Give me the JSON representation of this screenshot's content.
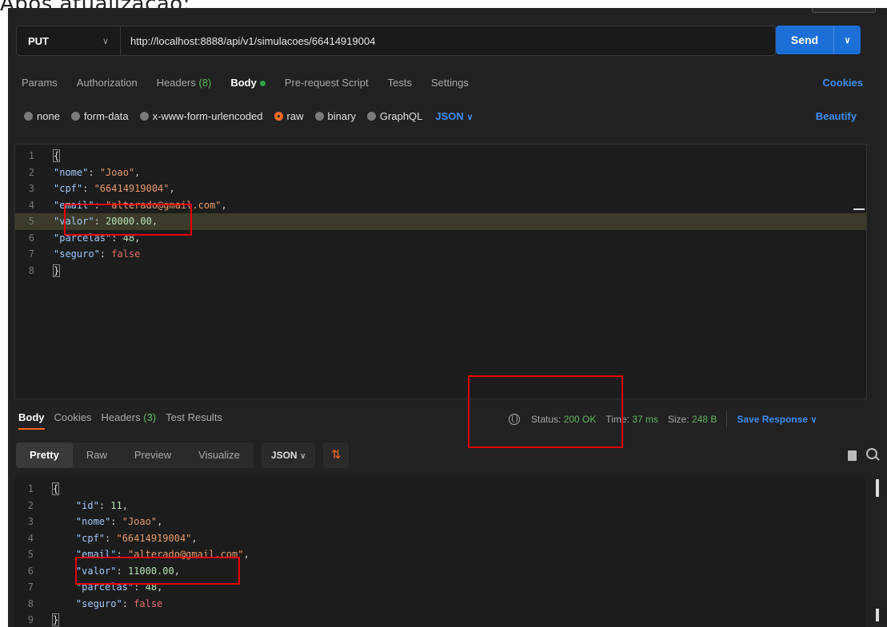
{
  "caption": "Após atualização:",
  "request": {
    "method": "PUT",
    "url": "http://localhost:8888/api/v1/simulacoes/66414919004",
    "send_label": "Send"
  },
  "tabs": [
    {
      "label": "Params"
    },
    {
      "label": "Authorization"
    },
    {
      "label": "Headers",
      "count": "(8)"
    },
    {
      "label": "Body"
    },
    {
      "label": "Pre-request Script"
    },
    {
      "label": "Tests"
    },
    {
      "label": "Settings"
    }
  ],
  "cookies_label": "Cookies",
  "body_types": [
    "none",
    "form-data",
    "x-www-form-urlencoded",
    "raw",
    "binary",
    "GraphQL"
  ],
  "body_format": "JSON",
  "beautify_label": "Beautify",
  "request_body": {
    "line_numbers": [
      "1",
      "2",
      "3",
      "4",
      "5",
      "6",
      "7",
      "8"
    ],
    "l1": "{",
    "l2_key": "\"nome\"",
    "l2_val": "\"Joao\"",
    "l3_key": "\"cpf\"",
    "l3_val": "\"66414919004\"",
    "l4_key": "\"email\"",
    "l4_val": "\"alterado@gmail.com\"",
    "l5_key": "\"valor\"",
    "l5_val": "20000.00",
    "l6_key": "\"parcelas\"",
    "l6_val": "48",
    "l7_key": "\"seguro\"",
    "l7_val": "false",
    "l8": "}"
  },
  "response_tabs": {
    "body": "Body",
    "cookies": "Cookies",
    "headers": "Headers",
    "headers_count": "(3)",
    "test_results": "Test Results"
  },
  "status": {
    "label": "Status:",
    "value": "200 OK",
    "time_label": "Time:",
    "time_value": "37 ms",
    "size_label": "Size:",
    "size_value": "248 B",
    "save_response": "Save Response"
  },
  "response_formats": [
    "Pretty",
    "Raw",
    "Preview",
    "Visualize"
  ],
  "response_format_select": "JSON",
  "response_body": {
    "line_numbers": [
      "1",
      "2",
      "3",
      "4",
      "5",
      "6",
      "7",
      "8",
      "9"
    ],
    "l1": "{",
    "l2_key": "\"id\"",
    "l2_val": "11",
    "l3_key": "\"nome\"",
    "l3_val": "\"Joao\"",
    "l4_key": "\"cpf\"",
    "l4_val": "\"66414919004\"",
    "l5_key": "\"email\"",
    "l5_val": "\"alterado@gmail.com\"",
    "l6_key": "\"valor\"",
    "l6_val": "11000.00",
    "l7_key": "\"parcelas\"",
    "l7_val": "48",
    "l8_key": "\"seguro\"",
    "l8_val": "false",
    "l9": "}"
  },
  "colors": {
    "accent": "#1c6fd6",
    "success": "#5fb85f",
    "orange": "#f06a23",
    "highlight_box": "#e50000"
  }
}
